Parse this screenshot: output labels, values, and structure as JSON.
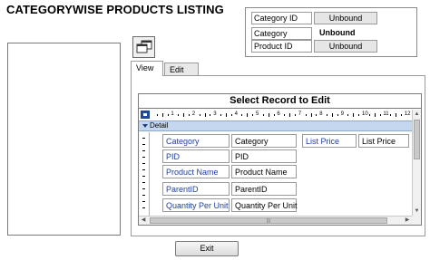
{
  "title": "CATEGORYWISE PRODUCTS LISTING",
  "header_info": [
    {
      "label": "Category ID",
      "value": "Unbound"
    },
    {
      "label": "Category",
      "value": "Unbound"
    },
    {
      "label": "Product ID",
      "value": "Unbound"
    }
  ],
  "tabs": [
    "View",
    "Edit"
  ],
  "subform": {
    "header": "Select Record to Edit",
    "section": "Detail",
    "ruler_numbers": [
      "1",
      "2",
      "3",
      "4",
      "5",
      "6",
      "7",
      "8",
      "9",
      "10",
      "11",
      "12"
    ],
    "fields": [
      {
        "label": "Category",
        "value": "Category"
      },
      {
        "label": "PID",
        "value": "PID"
      },
      {
        "label": "Product Name",
        "value": "Product Name"
      },
      {
        "label": "ParentID",
        "value": "ParentID"
      },
      {
        "label": "Quantity Per Unit",
        "value": "Quantity Per Unit"
      },
      {
        "label": "List Price",
        "value": "List Price"
      }
    ]
  },
  "buttons": {
    "exit": "Exit"
  },
  "icons": {
    "forms": "windows-stack-icon",
    "detail": "chevron-down-icon",
    "corner": "form-selector-icon"
  },
  "colors": {
    "label_text": "#1f3f9c",
    "detail_bar": "#c5d6ef",
    "form_selector": "#1f4e9c"
  }
}
